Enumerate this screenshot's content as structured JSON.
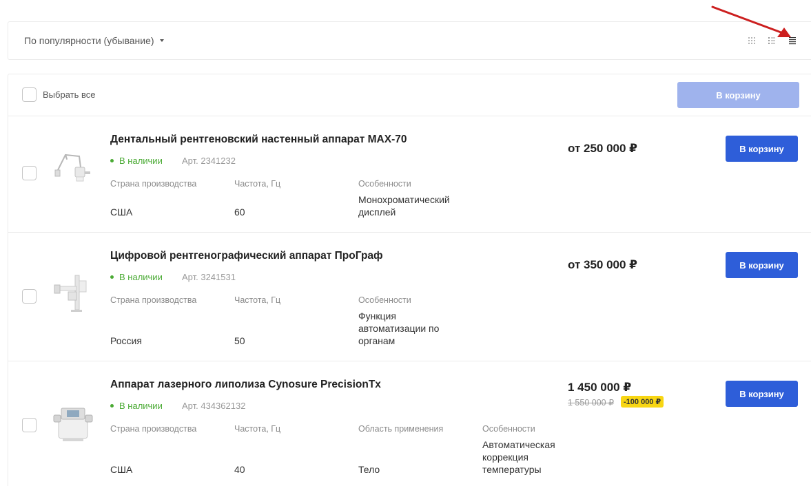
{
  "sort": {
    "label": "По популярности (убывание)"
  },
  "views": {
    "tile": "tile-view-icon",
    "list": "list-view-icon",
    "table": "table-view-icon"
  },
  "selection": {
    "select_all_label": "Выбрать все",
    "cart_button": "В корзину"
  },
  "colors": {
    "accent": "#2e5ed9",
    "accent_disabled": "#9fb3ed",
    "in_stock": "#4aaa34",
    "discount_bg": "#f8d613",
    "annotation_arrow": "#cc1f1f"
  },
  "products": [
    {
      "title": "Дентальный рентгеновский настенный аппарат MAX-70",
      "stock": "В наличии",
      "art": "Арт. 2341232",
      "props": [
        {
          "label": "Страна производства",
          "value": "США"
        },
        {
          "label": "Частота, Гц",
          "value": "60"
        },
        {
          "label": "Особенности",
          "value": "Монохроматический дисплей"
        }
      ],
      "price": "от 250 000 ₽",
      "cart_button": "В корзину"
    },
    {
      "title": "Цифровой рентгенографический аппарат ПроГраф",
      "stock": "В наличии",
      "art": "Арт. 3241531",
      "props": [
        {
          "label": "Страна производства",
          "value": "Россия"
        },
        {
          "label": "Частота, Гц",
          "value": "50"
        },
        {
          "label": "Особенности",
          "value": "Функция автоматизации по органам"
        }
      ],
      "price": "от 350 000 ₽",
      "cart_button": "В корзину"
    },
    {
      "title": "Аппарат лазерного липолиза Cynosure PrecisionTx",
      "stock": "В наличии",
      "art": "Арт. 434362132",
      "props": [
        {
          "label": "Страна производства",
          "value": "США"
        },
        {
          "label": "Частота, Гц",
          "value": "40"
        },
        {
          "label": "Область применения",
          "value": "Тело"
        },
        {
          "label": "Особенности",
          "value": "Автоматическая коррекция температуры"
        }
      ],
      "price": "1 450 000 ₽",
      "old_price": "1 550 000 ₽",
      "discount": "-100 000 ₽",
      "cart_button": "В корзину"
    }
  ]
}
